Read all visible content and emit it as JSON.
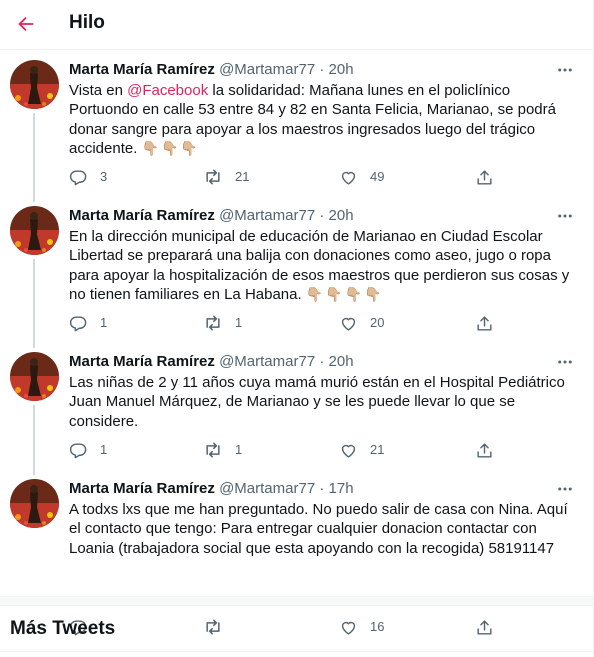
{
  "header": {
    "title": "Hilo"
  },
  "colors": {
    "accent": "#e0245e",
    "secondary_text": "#536471",
    "thread_line": "#cfd9de"
  },
  "tweets": [
    {
      "author": "Marta María Ramírez",
      "handle": "@Martamar77",
      "dot": "·",
      "time": "20h",
      "text_before": "Vista en ",
      "mention": "@Facebook",
      "text_after": " la solidaridad: Mañana lunes en el policlínico Portuondo en calle 53 entre 84 y 82 en Santa Felicia, Marianao, se podrá donar sangre para apoyar a los maestros ingresados luego del trágico accidente.",
      "emoji": "👇🏼👇🏼👇🏼",
      "replies": "3",
      "retweets": "21",
      "likes": "49"
    },
    {
      "author": "Marta María Ramírez",
      "handle": "@Martamar77",
      "dot": "·",
      "time": "20h",
      "text": "En la dirección municipal de educación de Marianao en Ciudad Escolar Libertad se preparará una balija con donaciones como aseo, jugo o ropa para apoyar la hospitalización de esos maestros que perdieron sus cosas y no tienen familiares en La Habana.",
      "emoji": "👇🏼👇🏼👇🏼👇🏼",
      "replies": "1",
      "retweets": "1",
      "likes": "20"
    },
    {
      "author": "Marta María Ramírez",
      "handle": "@Martamar77",
      "dot": "·",
      "time": "20h",
      "text": "Las niñas de 2 y 11 años cuya mamá murió están en el Hospital Pediátrico Juan Manuel Márquez, de Marianao y se les puede llevar lo que se considere.",
      "replies": "1",
      "retweets": "1",
      "likes": "21"
    },
    {
      "author": "Marta María Ramírez",
      "handle": "@Martamar77",
      "dot": "·",
      "time": "17h",
      "text": "A todxs lxs que me han preguntado. No puedo salir de casa con Nina. Aquí el contacto que tengo: Para entregar cualquier donacion contactar con Loania (trabajadora social que esta apoyando con la recogida) 58191147",
      "replies": "",
      "retweets": "",
      "likes": "16"
    }
  ],
  "more_tweets": {
    "title": "Más Tweets"
  },
  "icons": {
    "back": "arrow-left-icon",
    "more": "more-dots-icon",
    "reply": "reply-bubble-icon",
    "retweet": "retweet-icon",
    "like": "heart-icon",
    "share": "share-icon"
  }
}
